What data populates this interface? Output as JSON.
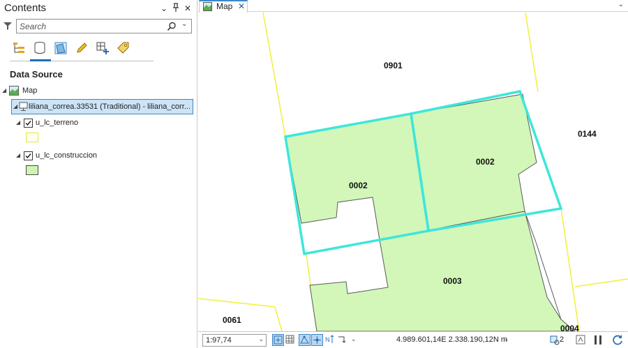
{
  "contents": {
    "title": "Contents",
    "header_buttons": {
      "dropdown": "⌄",
      "pin": "⊥",
      "close": "✕"
    },
    "search": {
      "placeholder": "Search",
      "value": ""
    },
    "heading": "Data Source",
    "tree": {
      "map": {
        "label": "Map"
      },
      "database": {
        "label": "liliana_correa.33531 (Traditional) - liliana_corr..."
      },
      "layers": [
        {
          "label": "u_lc_terreno",
          "checked": true,
          "symbol_color": "#e8e82a"
        },
        {
          "label": "u_lc_construccion",
          "checked": true,
          "symbol_color": "#cff5b5"
        }
      ]
    }
  },
  "map_view": {
    "tab_label": "Map",
    "parcel_labels": {
      "p0901": "0901",
      "p0144": "0144",
      "p0002a": "0002",
      "p0002b": "0002",
      "p0003": "0003",
      "p0061": "0061",
      "p0004": "0004"
    },
    "colors": {
      "terreno_outline": "#f0f03c",
      "construccion_fill": "#d2f7b9",
      "selection": "#3ee6da",
      "construccion_outline": "#5a5a5a"
    }
  },
  "statusbar": {
    "scale": "1:97,74",
    "coordinates": "4.989.601,14E 2.338.190,12N m",
    "selected_count": "2"
  },
  "icons": [
    "filter-icon",
    "search-icon",
    "list-by-drawing-order-icon",
    "list-by-data-source-icon",
    "list-by-selection-icon",
    "list-by-editing-icon",
    "list-by-snapping-icon",
    "list-by-labeling-icon",
    "map-icon",
    "database-icon"
  ]
}
